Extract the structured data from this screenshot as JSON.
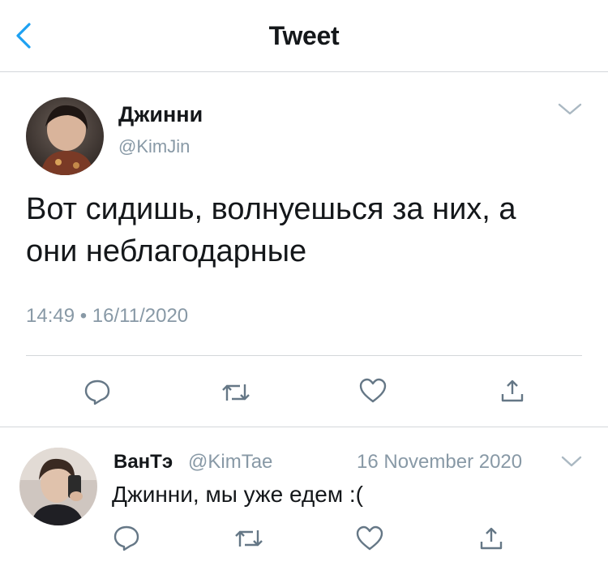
{
  "header": {
    "title": "Tweet",
    "back_icon": "chevron-left-icon"
  },
  "tweet": {
    "author_name": "Джинни",
    "author_handle": "@KimJin",
    "text_line1": "Вот сидишь, волнуешься за них, а",
    "text_line2": "они неблагодарные",
    "timestamp": "14:49 • 16/11/2020",
    "actions": [
      "reply-icon",
      "retweet-icon",
      "like-icon",
      "share-icon"
    ]
  },
  "reply": {
    "author_name": "ВанТэ",
    "author_handle": "@KimTae",
    "date": "16 November 2020",
    "text": "Джинни, мы уже едем :(",
    "actions": [
      "reply-icon",
      "retweet-icon",
      "like-icon",
      "share-icon"
    ]
  },
  "colors": {
    "accent": "#1da1f2",
    "icon_gray": "#657786",
    "handle_gray": "#8899a6",
    "divider": "#d4d7da"
  }
}
